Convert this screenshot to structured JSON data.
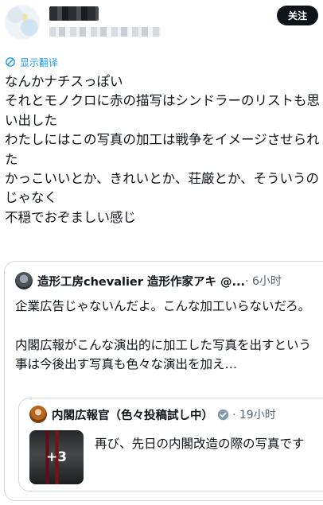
{
  "post": {
    "follow_label": "关注",
    "translate_label": "显示翻译",
    "text": "なんかナチスっぽい\nそれとモノクロに赤の描写はシンドラーのリストも思い出した\nわたしにはこの写真の加工は戦争をイメージさせられた\nかっこいいとか、きれいとか、荘厳とか、そういうのじゃなく\n不穏でおぞましい感じ"
  },
  "quote": {
    "author_name": "造形工房chevalier 造形作家アキ @...",
    "meta": "· 6小时",
    "text": "企業広告じゃないんだよ。こんな加工いらないだろ。\n\n内閣広報がこんな演出的に加工した写真を出すという事は今後出す写真も色々な演出を加え…"
  },
  "nested_quote": {
    "author_name": "内閣広報官（色々投稿試し中）",
    "meta": "· 19小时",
    "media_count": "+3",
    "text": "再び、先日の内閣改造の際の写真です"
  },
  "icons": {
    "translate": "translate-icon",
    "verified": "verified-badge-icon"
  },
  "colors": {
    "link": "#1d9bf0",
    "verified": "#829aab",
    "follow_button": "#0f1419"
  }
}
